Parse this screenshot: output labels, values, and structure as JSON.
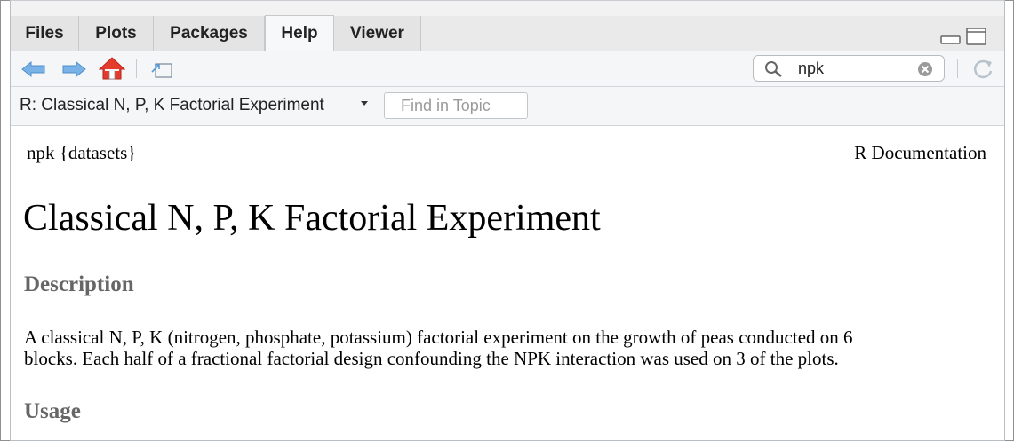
{
  "tabs": [
    {
      "label": "Files",
      "active": false
    },
    {
      "label": "Plots",
      "active": false
    },
    {
      "label": "Packages",
      "active": false
    },
    {
      "label": "Help",
      "active": true
    },
    {
      "label": "Viewer",
      "active": false
    }
  ],
  "toolbar": {
    "back_icon": "arrow-left-icon",
    "forward_icon": "arrow-right-icon",
    "home_icon": "home-icon",
    "popout_icon": "popout-icon",
    "search_value": "npk",
    "refresh_icon": "refresh-icon",
    "accent_color": "#5d9bd5"
  },
  "topic": {
    "title": "R: Classical N, P, K Factorial Experiment",
    "find_placeholder": "Find in Topic"
  },
  "doc": {
    "package": "npk {datasets}",
    "rdoc": "R Documentation",
    "title": "Classical N, P, K Factorial Experiment",
    "description_heading": "Description",
    "description_line1": "A classical N, P, K (nitrogen, phosphate, potassium) factorial experiment on the growth of peas conducted on 6",
    "description_line2": "blocks. Each half of a fractional factorial design confounding the NPK interaction was used on 3 of the plots.",
    "usage_heading": "Usage"
  }
}
